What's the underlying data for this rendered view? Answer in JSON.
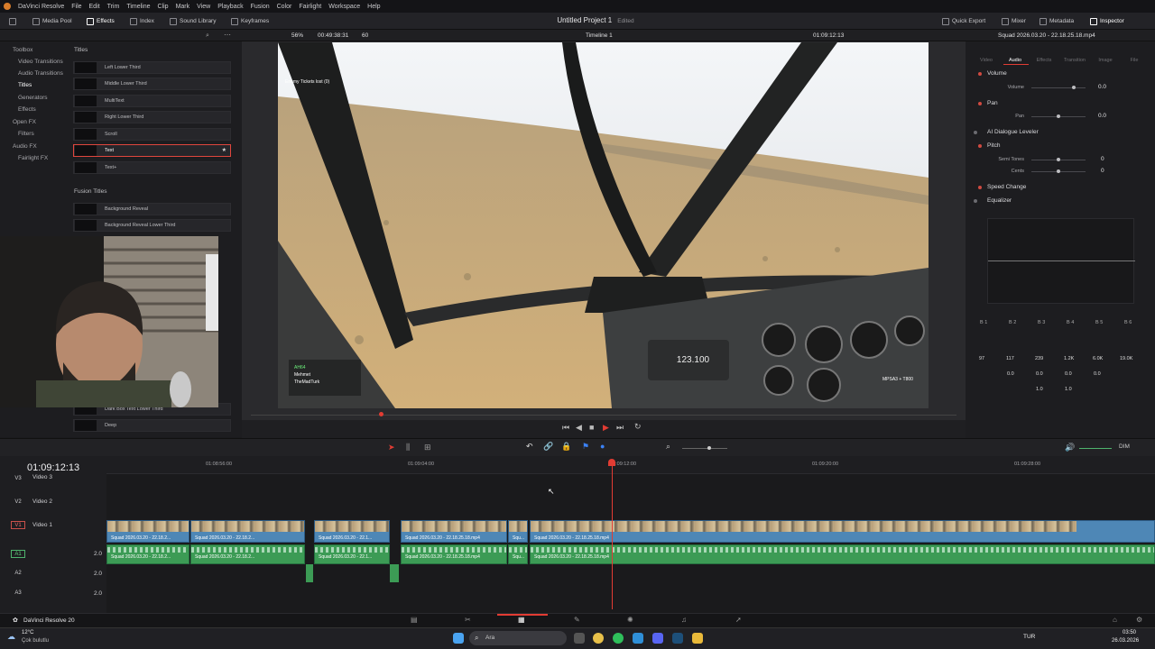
{
  "menubar": {
    "app": "DaVinci Resolve",
    "items": [
      "File",
      "Edit",
      "Trim",
      "Timeline",
      "Clip",
      "Mark",
      "View",
      "Playback",
      "Fusion",
      "Color",
      "Fairlight",
      "Workspace",
      "Help"
    ]
  },
  "toolbar": {
    "media_pool": "Media Pool",
    "effects": "Effects",
    "index": "Index",
    "sound_library": "Sound Library",
    "keyframes": "Keyframes",
    "project_title": "Untitled Project 1",
    "project_status": "Edited",
    "quick_export": "Quick Export",
    "mixer": "Mixer",
    "metadata": "Metadata",
    "inspector": "Inspector"
  },
  "viewer": {
    "zoom": "56%",
    "source_tc": "00:49:38:31",
    "fps": "60",
    "timeline_name": "Timeline 1",
    "record_tc": "01:09:12:13",
    "clip_name": "Squad 2026.03.20 - 22.18.25.18.mp4"
  },
  "effects": {
    "tree": [
      "Toolbox",
      "Video Transitions",
      "Audio Transitions",
      "Titles",
      "Generators",
      "Effects",
      "Open FX",
      "Filters",
      "Audio FX",
      "Fairlight FX"
    ],
    "titles_header": "Titles",
    "titles": [
      "Left Lower Third",
      "Middle Lower Third",
      "MultiText",
      "Right Lower Third",
      "Scroll",
      "Text",
      "Text+"
    ],
    "fusion_header": "Fusion Titles",
    "fusion_titles": [
      "Background Reveal",
      "Background Reveal Lower Third",
      "Dark Box Text Lower Third",
      "Deep"
    ]
  },
  "inspector": {
    "tabs": [
      "Video",
      "Audio",
      "Effects",
      "Transition",
      "Image",
      "File"
    ],
    "volume_header": "Volume",
    "volume_label": "Volume",
    "volume_value": "0.0",
    "pan_header": "Pan",
    "pan_label": "Pan",
    "pan_value": "0.0",
    "ai_leveler": "AI Dialogue Leveler",
    "pitch_header": "Pitch",
    "semitones_label": "Semi Tones",
    "semitones_value": "0",
    "cents_label": "Cents",
    "cents_value": "0",
    "speed_change": "Speed Change",
    "equalizer": "Equalizer",
    "eq_bands": [
      "B 1",
      "B 2",
      "B 3",
      "B 4",
      "B 5",
      "B 6"
    ],
    "eq_freq": [
      "97",
      "117",
      "239",
      "1.2K",
      "6.0K",
      "19.0K"
    ],
    "eq_gain": [
      "",
      "0.0",
      "0.0",
      "0.0",
      "0.0",
      ""
    ],
    "eq_q": [
      "",
      "",
      "1.0",
      "1.0",
      "",
      ""
    ]
  },
  "timeline": {
    "timecode": "01:09:12:13",
    "ruler": [
      "01:08:56:00",
      "01:09:04:00",
      "01:09:12:00",
      "01:09:20:00",
      "01:09:28:00"
    ],
    "tracks": [
      {
        "id": "V3",
        "name": "Video 3"
      },
      {
        "id": "V2",
        "name": "Video 2"
      },
      {
        "id": "V1",
        "name": "Video 1"
      },
      {
        "id": "A1",
        "name": "",
        "level": "2.0"
      },
      {
        "id": "A2",
        "name": "",
        "level": "2.0"
      },
      {
        "id": "A3",
        "name": "",
        "level": "2.0"
      }
    ],
    "clip_full": "Squad 2026.03.20 - 22.18.25.18.mp4",
    "clip_short1": "Squad 2026.03.20 - 22.18.2...",
    "clip_short2": "Squad 2026.03.20 - 22.1...",
    "clip_tiny": "Squ...",
    "dim_label": "DIM"
  },
  "video_overlay": {
    "tickets": "Enemy Tickets lost (0)",
    "hud_readout": "123.100",
    "callout": "MPSA3 + T800",
    "squad": [
      "AH64",
      "Mehmet",
      "TheMadTurk"
    ]
  },
  "pagebar": {
    "app": "DaVinci Resolve 20"
  },
  "taskbar": {
    "temp": "12°C",
    "weather": "Çok bulutlu",
    "search": "Ara",
    "lang": "TUR",
    "time": "03:50",
    "date": "26.03.2026"
  },
  "colors": {
    "accent_red": "#e23c33",
    "video_clip": "#4e87b6",
    "audio_clip": "#3c9b55",
    "bg_panel": "#1d1d20"
  }
}
